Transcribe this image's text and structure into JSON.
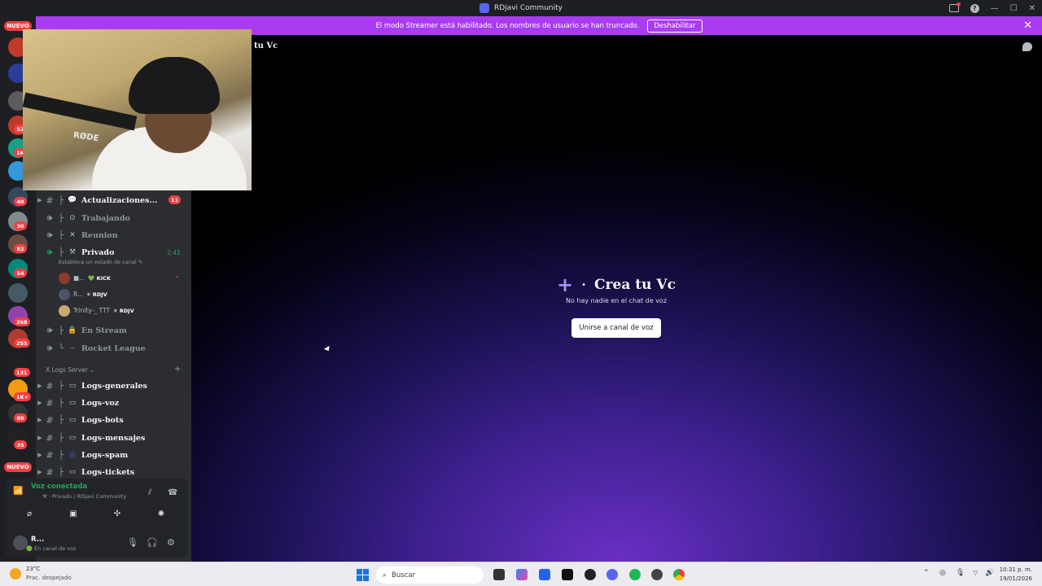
{
  "window": {
    "title": "RDjavi Community"
  },
  "banner": {
    "message": "El modo Streamer está habilitado. Los nombres de usuario se han truncado.",
    "disable_label": "Deshabilitar",
    "close_icon": "close-icon"
  },
  "rail": {
    "top_pill": "NUEVO",
    "bottom_pill": "NUEVO",
    "badges": [
      "52",
      "1K",
      "48",
      "30",
      "82",
      "54",
      "268",
      "255",
      "131",
      "1K+",
      "80",
      "35"
    ]
  },
  "header": {
    "channel": "tu Vc"
  },
  "channels": [
    {
      "emoji": "💬",
      "name": "Actualizaciones...",
      "badge": "11",
      "icon": "text-channel-icon",
      "muted": false
    },
    {
      "emoji": "⊙",
      "name": "Trabajando",
      "icon": "voice-channel-icon",
      "muted": true
    },
    {
      "emoji": "✕",
      "name": "Reunion",
      "icon": "voice-channel-icon",
      "muted": true
    },
    {
      "emoji": "⚒",
      "name": "Privado",
      "timer": "2:41",
      "icon": "voice-channel-icon",
      "muted": false
    }
  ],
  "voice_status_hint": "Establece un estado de canal ✎",
  "voice_users": [
    {
      "name": "■...",
      "tag": "💚 KICK"
    },
    {
      "name": "R...",
      "tag": "✳ RDJV"
    },
    {
      "name": "Trinity-_ TTT",
      "tag": "✳ RDJV"
    }
  ],
  "channels_2": [
    {
      "emoji": "🔒",
      "name": "En Stream"
    },
    {
      "emoji": "⎯",
      "name": "Rocket League"
    }
  ],
  "category": {
    "label": "X Logs Server ⌄",
    "add": "+"
  },
  "log_channels": [
    {
      "emoji": "▭",
      "name": "Logs-generales"
    },
    {
      "emoji": "▭",
      "name": "Logs-voz"
    },
    {
      "emoji": "▭",
      "name": "Logs-bots"
    },
    {
      "emoji": "▭",
      "name": "Logs-mensajes"
    },
    {
      "emoji": "◎",
      "name": "Logs-spam"
    },
    {
      "emoji": "▭",
      "name": "Logs-tickets"
    }
  ],
  "voice_panel": {
    "status": "Voz conectada",
    "location": "⚒ · Privado / RDjavi Community"
  },
  "user_bar": {
    "name": "R...",
    "status": "🟢 En canal de voz"
  },
  "stage": {
    "title": "Crea tu Vc",
    "subtitle": "No hay nadie en el chat de voz",
    "join_label": "Unirse a canal de voz"
  },
  "webcam": {
    "mic_brand": "RØDE"
  },
  "taskbar": {
    "temp": "23°C",
    "condition": "Prac. despejado",
    "search_placeholder": "Buscar",
    "time": "10:31 p. m.",
    "date": "19/01/2026"
  },
  "colors": {
    "banner": "#a93cf0",
    "online": "#23a55a",
    "badge": "#f23f43",
    "stage_glow": "#6a2fc4"
  }
}
